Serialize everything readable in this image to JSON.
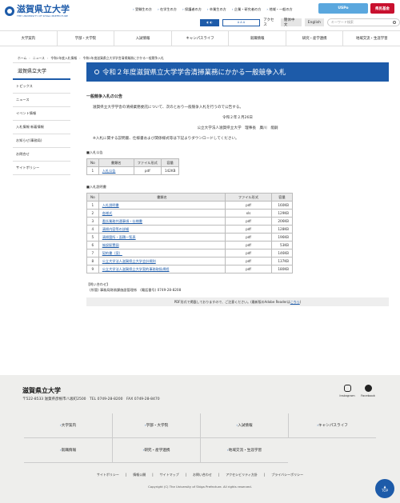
{
  "header": {
    "logo_jp": "滋賀県立大学",
    "logo_en": "THE UNIVERSITY OF SHIGA PREFECTURE",
    "top_links": [
      "受験生の方",
      "在学生の方",
      "保護者の方",
      "卒業生の方",
      "企業・研究者の方",
      "地域・一般の方"
    ],
    "usp_label": "USPo",
    "fund_label": "県民基金",
    "access_label": "アクセス",
    "lang_zh": "簡体中文",
    "lang_en": "English",
    "search_placeholder": "キーワード検索"
  },
  "gnav": [
    "大学案内",
    "学部・大学院",
    "入試情報",
    "キャンパスライフ",
    "就職情報",
    "研究・産学連携",
    "地域交流・生涯学習"
  ],
  "breadcrumb": [
    "ホーム",
    "ニュース",
    "令和2年度入札情報",
    "令和2年度滋賀県立大学学舎清掃業務にかかる一般競争入札"
  ],
  "sidebar": {
    "title": "滋賀県立大学",
    "items": [
      "トピックス",
      "ニュース",
      "イベント情報",
      "入札情報 新着情報",
      "お知らせ(事務局)",
      "お問合せ",
      "サイトポリシー"
    ]
  },
  "main": {
    "title": "令和２年度滋賀県立大学学舎清掃業務にかかる一般競争入札",
    "section": "一般競争入札の公告",
    "body": "滋賀県立大学学舎の清掃業務委託について、次のとおり一般競争入札を行うので公告する。",
    "date": "令和２年２月26日",
    "signer": "公立大学法人滋賀県立大学　理事長　廣川　能嗣",
    "notice": "※入札に関する説明書、仕様書および関係様式等は下記よりダウンロードしてください。",
    "table1_caption": "■入札公告",
    "table1_headers": [
      "No",
      "書類名",
      "ファイル形式",
      "容量"
    ],
    "table1_rows": [
      [
        "1",
        "入札公告",
        "pdf",
        "142KB"
      ]
    ],
    "table2_caption": "■入札説明書",
    "table2_headers": [
      "No",
      "書類名",
      "ファイル形式",
      "容量"
    ],
    "table2_rows": [
      [
        "1",
        "入札説明書",
        "pdf",
        "160KB"
      ],
      [
        "2",
        "各様式",
        "xls",
        "129KB"
      ],
      [
        "3",
        "委託業務共通事項・仕様書",
        "pdf",
        "206KB"
      ],
      [
        "4",
        "清掃内容等の詳細",
        "pdf",
        "128KB"
      ],
      [
        "5",
        "清掃箇所・面積一覧表",
        "pdf",
        "196KB"
      ],
      [
        "6",
        "施設配置図",
        "pdf",
        "53KB"
      ],
      [
        "7",
        "契約書（案）",
        "pdf",
        "146KB"
      ],
      [
        "8",
        "公立大学法人滋賀県立大学会計規則",
        "pdf",
        "137KB"
      ],
      [
        "9",
        "公立大学法人滋賀県立大学契約事務取扱規程",
        "pdf",
        "180KB"
      ]
    ],
    "contact_label": "【問い合わせ】",
    "contact": "(所管) 事務局財務課施設管理係　(電話番号) 0749-28-8208",
    "pdf_note": "PDF形式で掲載しておりますので、ご注意ください。(最新版のAdobe Readerは",
    "pdf_link": "こちら",
    "pdf_tail": ")"
  },
  "footer": {
    "title": "滋賀県立大学",
    "address": "〒522-8533 滋賀県彦根市八坂町2500　TEL 0749-28-8200　FAX 0749-28-8470",
    "instagram": "Instagram",
    "facebook": "Facebook",
    "nav": [
      "大学案内",
      "学部・大学院",
      "入試情報",
      "キャンパスライフ",
      "就職情報",
      "研究・産学連携",
      "地域交流・生涯学習"
    ],
    "links": [
      "サイトポリシー",
      "情報公開",
      "サイトマップ",
      "お問い合わせ",
      "アクセシビリティ方針",
      "プライバシーポリシー"
    ],
    "copyright": "Copyright (C) The University of Shiga Prefecture. All rights reserved.",
    "top": "TOP"
  }
}
